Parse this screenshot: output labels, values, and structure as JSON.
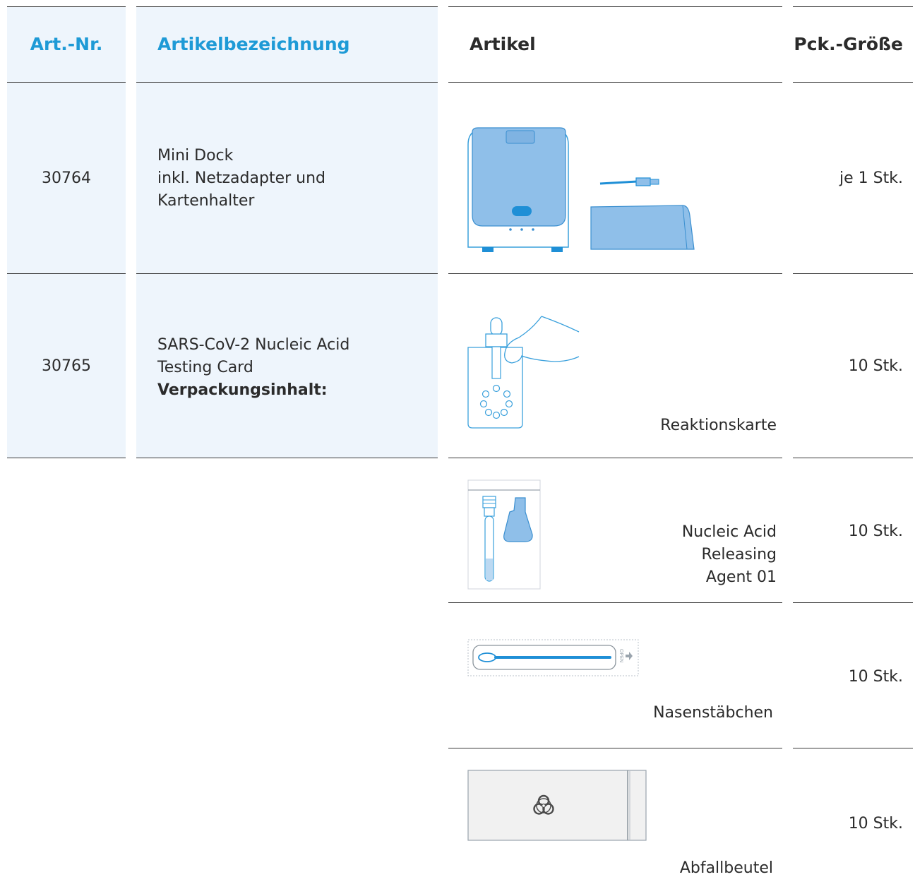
{
  "table": {
    "headers": {
      "art_nr": "Art.-Nr.",
      "bezeichnung": "Artikelbezeichnung",
      "artikel": "Artikel",
      "pck_groesse": "Pck.-Größe"
    },
    "rows": [
      {
        "art_nr": "30764",
        "bezeichnung_lines": [
          "Mini Dock",
          "inkl. Netzadapter und",
          "Kartenhalter"
        ],
        "pck_groesse": "je 1 Stk."
      },
      {
        "art_nr": "30765",
        "bezeichnung_lines": [
          "SARS-CoV-2 Nucleic Acid",
          "Testing Card"
        ],
        "bezeichnung_bold": "Verpackungsinhalt:",
        "pck_groesse": "10 Stk."
      }
    ],
    "contents": [
      {
        "label": "Reaktionskarte",
        "pck_groesse": "10 Stk."
      },
      {
        "label_lines": [
          "Nucleic Acid",
          "Releasing",
          "Agent 01"
        ],
        "pck_groesse": "10 Stk."
      },
      {
        "label": "Nasenstäbchen",
        "pck_groesse": "10 Stk.",
        "swab_text": "OPEN"
      },
      {
        "label": "Abfallbeutel",
        "pck_groesse": "10 Stk."
      }
    ]
  },
  "colors": {
    "header_blue": "#1e9ad6",
    "shade": "#eef5fc",
    "device_blue": "#8fbfe9",
    "accent_blue": "#1f8fd6",
    "outline_blue": "#3aa0dc",
    "rule": "#3a3a3a"
  }
}
